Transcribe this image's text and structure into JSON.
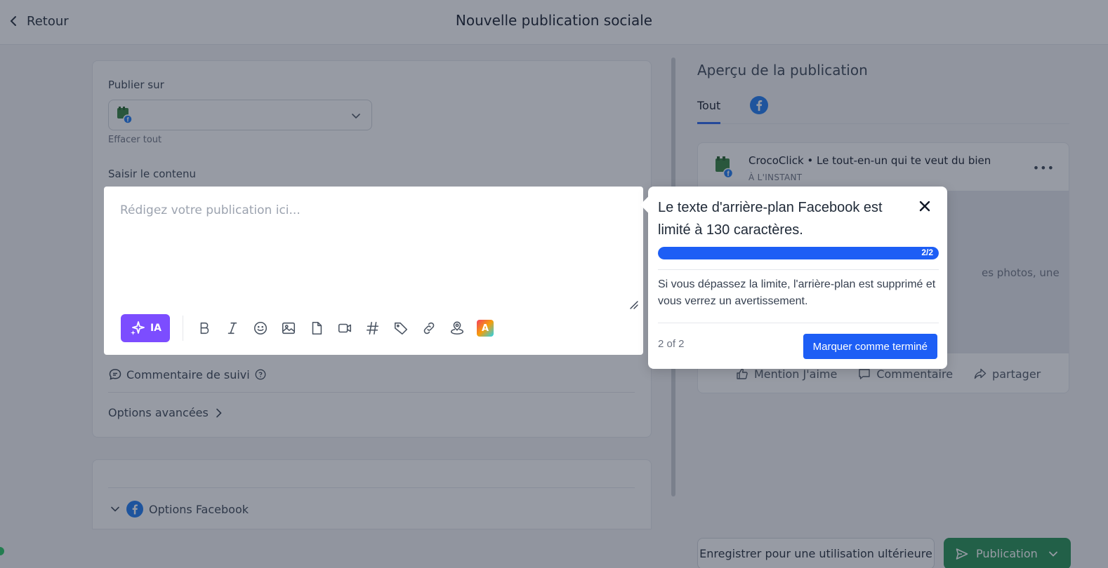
{
  "header": {
    "back_label": "Retour",
    "title": "Nouvelle publication sociale"
  },
  "composer": {
    "publish_on_label": "Publier sur",
    "clear_all": "Effacer tout",
    "content_label": "Saisir le contenu",
    "editor_placeholder": "Rédigez votre publication ici...",
    "ai_button_label": "IA",
    "canva_label": "A",
    "followup_label": "Commentaire de suivi",
    "advanced_label": "Options avancées",
    "facebook_options_label": "Options Facebook"
  },
  "preview": {
    "title": "Aperçu de la publication",
    "tab_all": "Tout",
    "account_name": "CrocoClick • Le tout-en-un qui te veut du bien",
    "timestamp": "À L'INSTANT",
    "body_hint": "es photos, une",
    "actions": [
      "Mention J'aime",
      "Commentaire",
      "partager"
    ]
  },
  "footer": {
    "save_label": "Enregistrer pour une utilisation ultérieure",
    "publish_label": "Publication"
  },
  "tour": {
    "title": "Le texte d'arrière-plan Facebook est limité à 130 caractères.",
    "step": "2/2",
    "progress": 1.0,
    "body": "Si vous dépassez la limite, l'arrière-plan est supprimé et vous verrez un avertissement.",
    "count": "2 of 2",
    "done_label": "Marquer comme terminé"
  },
  "colors": {
    "facebook_blue": "#1877f2",
    "ai_purple": "#7c4dff",
    "publish_green": "#1f8e50",
    "tour_blue": "#1d5ef5"
  }
}
